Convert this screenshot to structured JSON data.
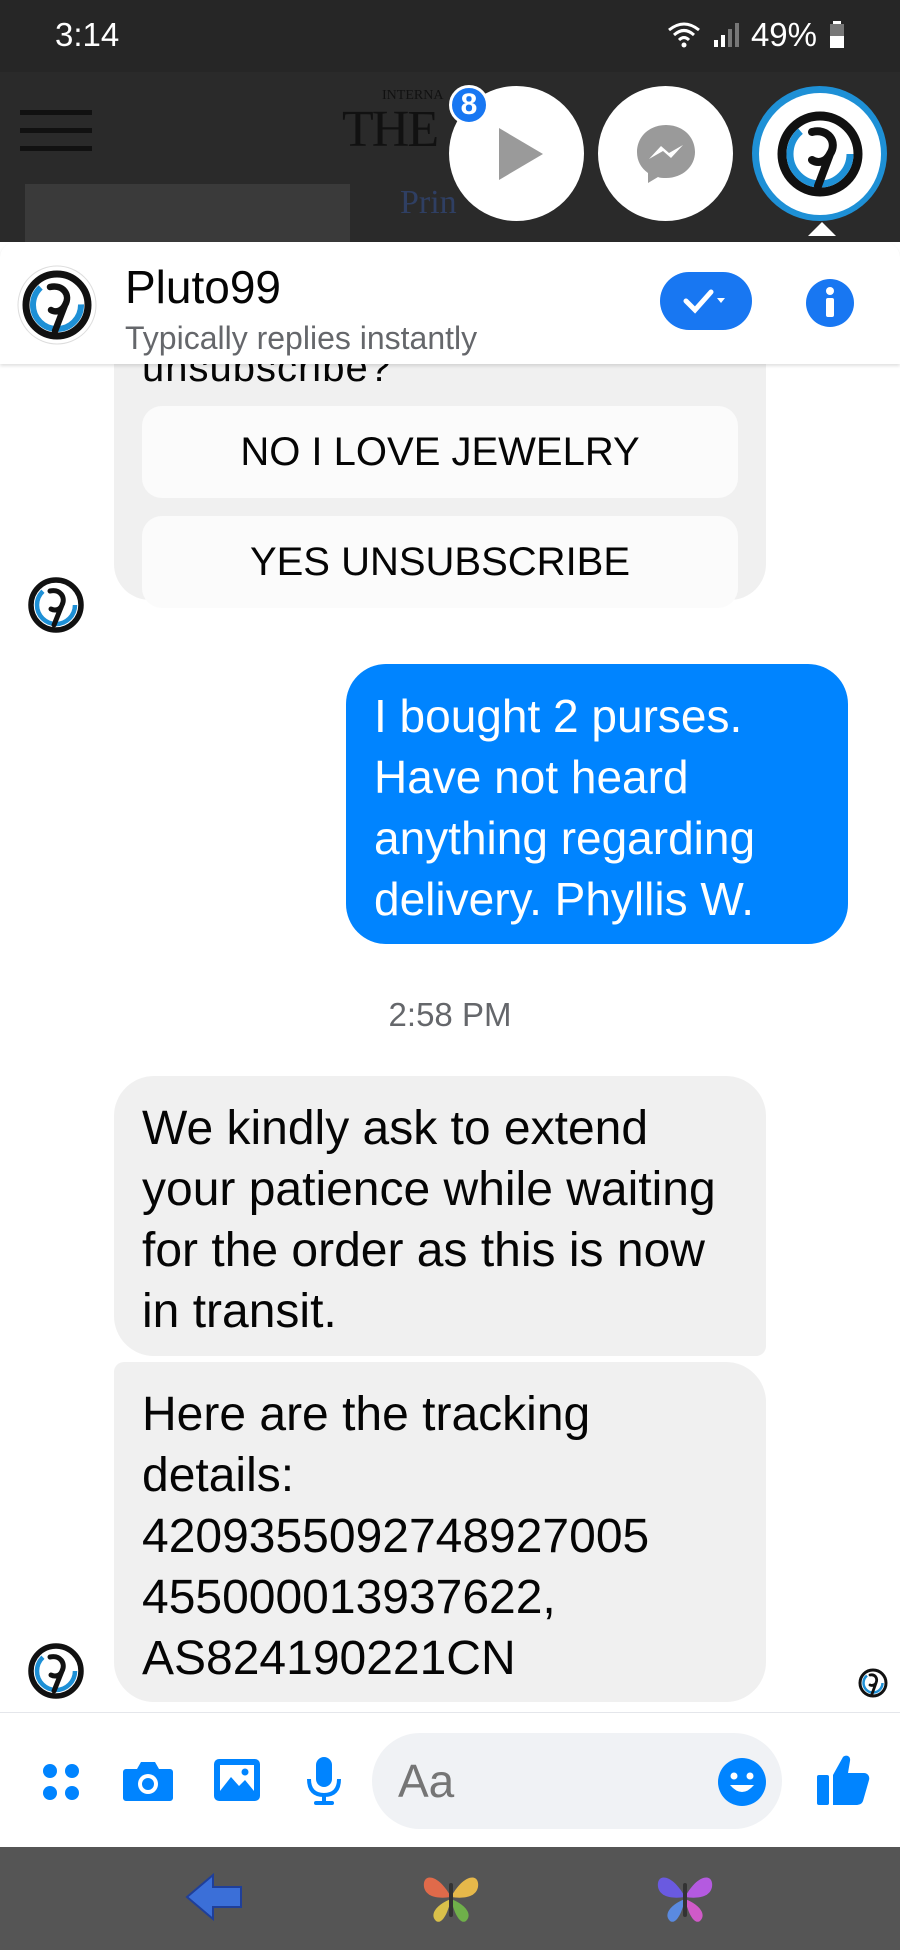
{
  "status_bar": {
    "time": "3:14",
    "battery": "49%"
  },
  "background_app": {
    "logo_small": "INTERNA",
    "logo": "THE",
    "snippet": "Prin"
  },
  "chat_heads": {
    "badge_count": "8"
  },
  "header": {
    "name": "Pluto99",
    "subtitle": "Typically replies instantly"
  },
  "quick_reply_card": {
    "cut_text": "unsubscribe?",
    "options": [
      "NO I LOVE JEWELRY",
      "YES UNSUBSCRIBE"
    ]
  },
  "messages": {
    "outgoing": "I bought 2 purses. Have not heard anything regarding delivery.  Phyllis W.",
    "timestamp": "2:58 PM",
    "incoming_1": "We kindly ask to extend your patience while waiting for the order as this is now in transit.",
    "incoming_2": "Here are the tracking details:\n4209355092748927005\n455000013937622,\nAS824190221CN"
  },
  "composer": {
    "placeholder": "Aa"
  },
  "colors": {
    "accent": "#0084ff",
    "incoming_bg": "#f0f0f0",
    "nav_bg": "#555555"
  },
  "icons": [
    "menu-icon",
    "play-icon",
    "messenger-icon",
    "check-icon",
    "info-icon",
    "apps-icon",
    "camera-icon",
    "gallery-icon",
    "mic-icon",
    "emoji-icon",
    "like-icon",
    "back-arrow-icon",
    "butterfly-icon"
  ]
}
